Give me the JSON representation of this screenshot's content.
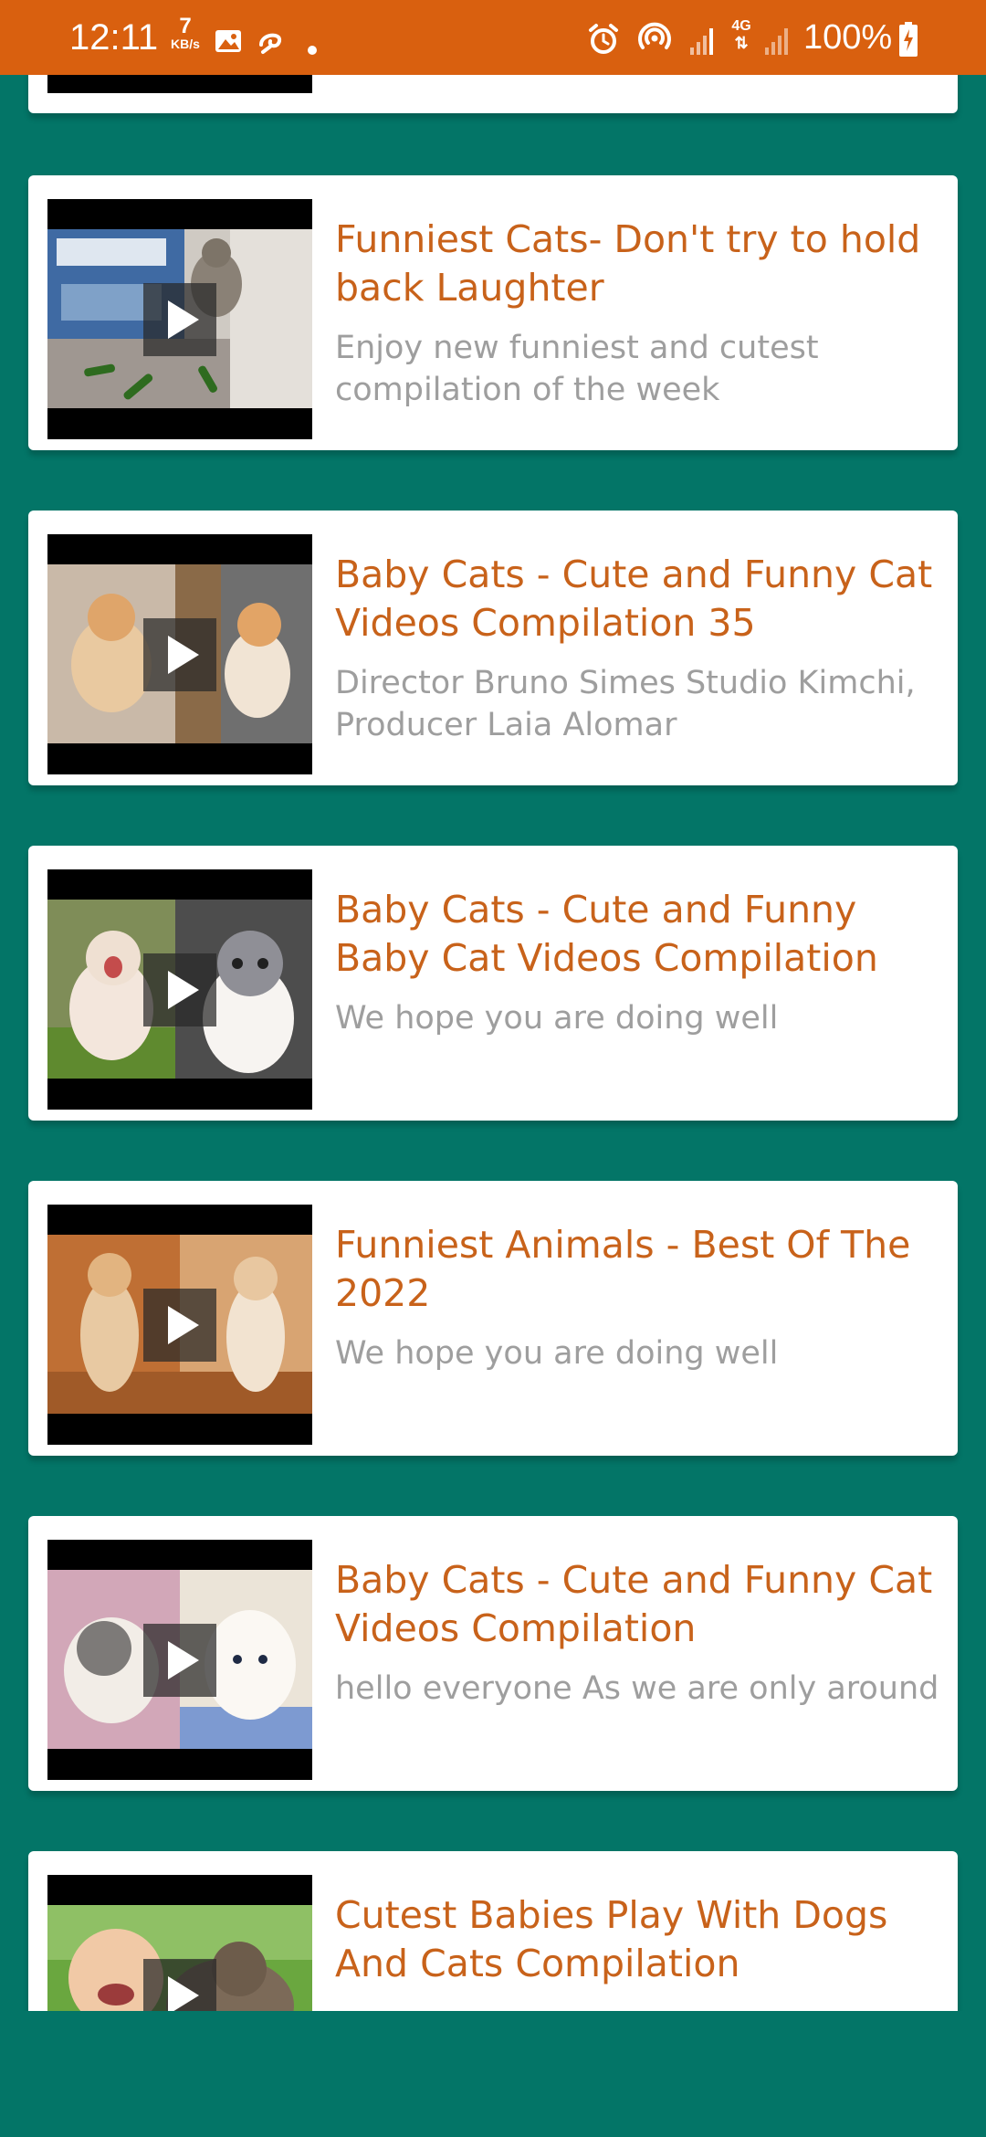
{
  "status_bar": {
    "time": "12:11",
    "net_speed_value": "7",
    "net_speed_unit": "KB/s",
    "notification_icons": [
      "image-icon",
      "swirl-app-icon",
      "dot-icon"
    ],
    "system_icons": [
      "alarm-icon",
      "hotspot-icon",
      "signal-icon",
      "4g-signal-icon",
      "signal-2-icon"
    ],
    "battery_text": "100%",
    "network_type": "4G",
    "colors": {
      "background": "#D9600F",
      "text": "#FFFFFF"
    }
  },
  "colors": {
    "page_background": "#037567",
    "card_background": "#FFFFFF",
    "title": "#C8621A",
    "description": "#9E9E9E"
  },
  "videos": [
    {
      "title": "",
      "description": "",
      "thumbnail": "thumb-partial"
    },
    {
      "title": "Funniest Cats- Don't try to hold back Laughter",
      "description": "Enjoy new funniest and cutest compilation of the week",
      "thumbnail": "cat-cucumbers-thumbnail"
    },
    {
      "title": "Baby Cats - Cute and Funny Cat Videos Compilation 35",
      "description": "Director Bruno Simes Studio Kimchi, Producer Laia Alomar",
      "thumbnail": "ginger-kittens-thumbnail"
    },
    {
      "title": "Baby Cats - Cute and Funny Baby Cat Videos Compilation",
      "description": "We hope you are doing well",
      "thumbnail": "yawning-kittens-thumbnail"
    },
    {
      "title": "Funniest Animals - Best Of The 2022",
      "description": "We hope you are doing well",
      "thumbnail": "standing-kittens-thumbnail"
    },
    {
      "title": "Baby Cats - Cute and Funny Cat Videos Compilation",
      "description": "hello everyone As we are only around",
      "thumbnail": "fluffy-kittens-thumbnail"
    },
    {
      "title": "Cutest Babies Play With Dogs And Cats Compilation",
      "description": "",
      "thumbnail": "baby-and-cat-thumbnail"
    }
  ]
}
